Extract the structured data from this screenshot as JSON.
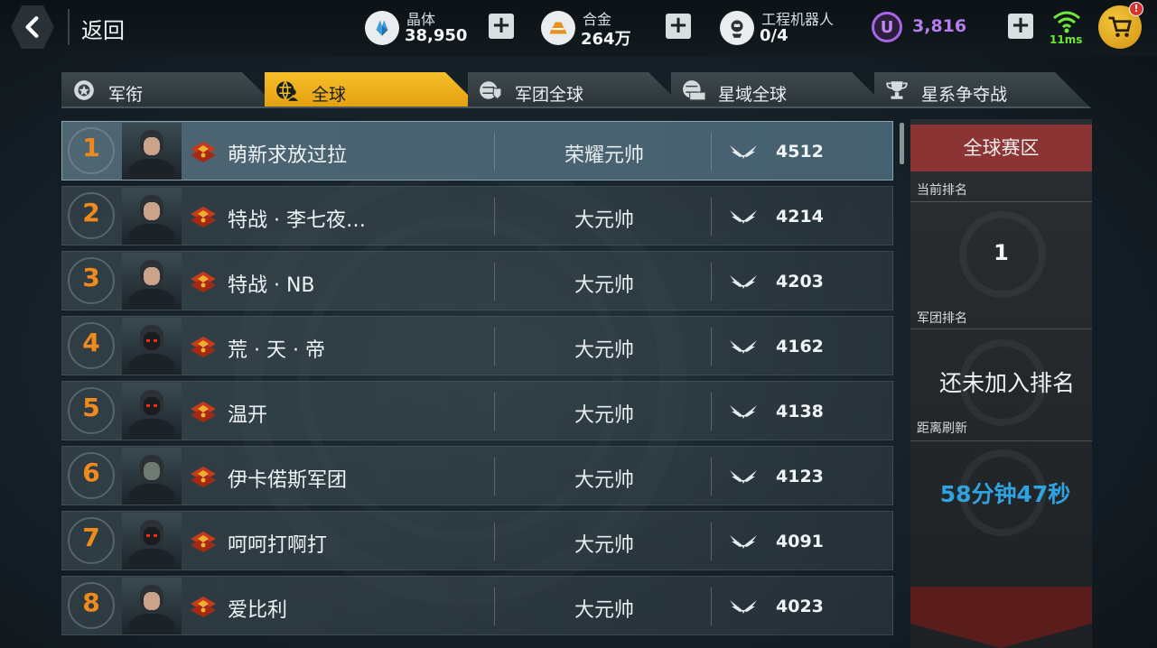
{
  "topbar": {
    "back_label": "返回",
    "resources": [
      {
        "label": "晶体",
        "value": "38,950",
        "icon": "crystal-icon"
      },
      {
        "label": "合金",
        "value": "264万",
        "icon": "alloy-icon"
      },
      {
        "label": "工程机器人",
        "value": "0/4",
        "icon": "robot-icon"
      }
    ],
    "premium_value": "3,816",
    "premium_icon_letter": "U",
    "ping": "11ms",
    "cart_badge": "!"
  },
  "tabs": [
    {
      "label": "军衔",
      "active": false,
      "icon": "rank-insignia-icon"
    },
    {
      "label": "全球",
      "active": true,
      "icon": "globe-players-icon"
    },
    {
      "label": "军团全球",
      "active": false,
      "icon": "legion-globe-icon"
    },
    {
      "label": "星域全球",
      "active": false,
      "icon": "sector-globe-icon"
    },
    {
      "label": "星系争夺战",
      "active": false,
      "icon": "trophy-icon"
    }
  ],
  "leaderboard": [
    {
      "rank": "1",
      "name": "萌新求放过拉",
      "title": "荣耀元帅",
      "score": "4512",
      "avatar": "sunglasses-man"
    },
    {
      "rank": "2",
      "name": "特战 · 李七夜…",
      "title": "大元帅",
      "score": "4214",
      "avatar": "woman"
    },
    {
      "rank": "3",
      "name": "特战 · NB",
      "title": "大元帅",
      "score": "4203",
      "avatar": "beret-soldier"
    },
    {
      "rank": "4",
      "name": "荒 · 天 · 帝",
      "title": "大元帅",
      "score": "4162",
      "avatar": "hooded"
    },
    {
      "rank": "5",
      "name": "温开",
      "title": "大元帅",
      "score": "4138",
      "avatar": "hooded"
    },
    {
      "rank": "6",
      "name": "伊卡偌斯军团",
      "title": "大元帅",
      "score": "4123",
      "avatar": "robot"
    },
    {
      "rank": "7",
      "name": "呵呵打啊打",
      "title": "大元帅",
      "score": "4091",
      "avatar": "hooded"
    },
    {
      "rank": "8",
      "name": "爱比利",
      "title": "大元帅",
      "score": "4023",
      "avatar": "woman"
    }
  ],
  "panel": {
    "header": "全球赛区",
    "current_rank_label": "当前排名",
    "current_rank": "1",
    "guild_rank_label": "军团排名",
    "guild_rank": "还未加入排名",
    "refresh_label": "距离刷新",
    "refresh_time": "58分钟47秒"
  },
  "colors": {
    "accent": "#f5bf2a",
    "rank_number": "#f08a1c",
    "panel_header": "#8a3534",
    "refresh_text": "#2ea3e0",
    "premium": "#b77cf0",
    "ping": "#6ee83a"
  }
}
